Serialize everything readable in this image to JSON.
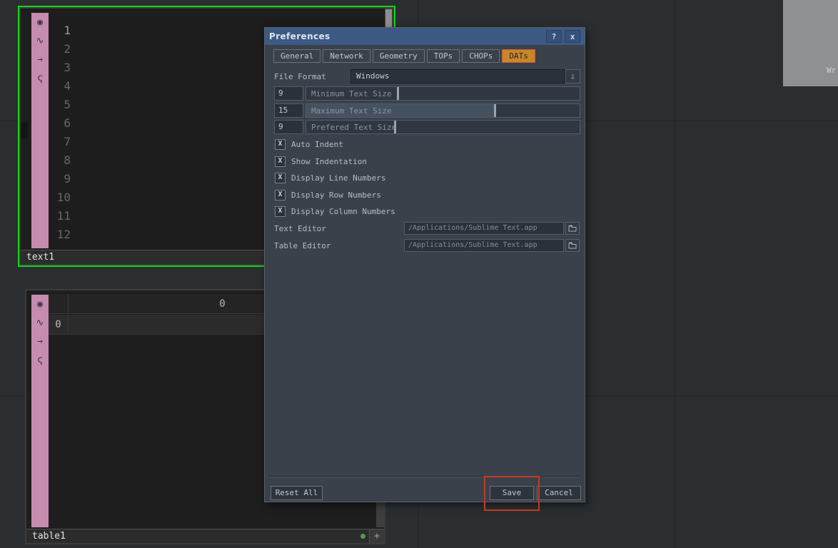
{
  "preferences_dialog": {
    "title": "Preferences",
    "help_label": "?",
    "close_label": "x",
    "tabs": [
      {
        "label": "General"
      },
      {
        "label": "Network"
      },
      {
        "label": "Geometry"
      },
      {
        "label": "TOPs"
      },
      {
        "label": "CHOPs"
      },
      {
        "label": "DATs",
        "active": true
      }
    ],
    "file_format": {
      "label": "File Format",
      "value": "Windows"
    },
    "sliders": [
      {
        "value": "9",
        "label": "Minimum Text Size"
      },
      {
        "value": "15",
        "label": "Maximum Text Size"
      },
      {
        "value": "9",
        "label": "Prefered Text Size"
      }
    ],
    "checkbox_mark": "X",
    "checkboxes": [
      {
        "label": "Auto Indent",
        "checked": true
      },
      {
        "label": "Show Indentation",
        "checked": true
      },
      {
        "label": "Display Line Numbers",
        "checked": true
      },
      {
        "label": "Display Row Numbers",
        "checked": true
      },
      {
        "label": "Display Column Numbers",
        "checked": true
      }
    ],
    "text_editor": {
      "label": "Text Editor",
      "value": "/Applications/Sublime Text.app"
    },
    "table_editor": {
      "label": "Table Editor",
      "value": "/Applications/Sublime Text.app"
    },
    "buttons": {
      "reset_all": "Reset All",
      "save": "Save",
      "cancel": "Cancel"
    }
  },
  "text_node": {
    "name": "text1",
    "line_numbers": [
      "1",
      "2",
      "3",
      "4",
      "5",
      "6",
      "7",
      "8",
      "9",
      "10",
      "11",
      "12"
    ]
  },
  "table_node": {
    "name": "table1",
    "col_header": "0",
    "row_header": "0",
    "add_label": "+"
  },
  "node_icons": {
    "viewer": "◉",
    "wave": "∿",
    "arrow": "→",
    "script": "ς"
  },
  "misc": {
    "dropdown_arrow": "⇩",
    "corner_text": "Wr"
  },
  "colors": {
    "selection_green": "#15d615",
    "active_tab_orange": "#c8872b",
    "annotation_red": "#c23b22",
    "node_pink": "#c58cb0",
    "titlebar_blue": "#3c5a84"
  }
}
